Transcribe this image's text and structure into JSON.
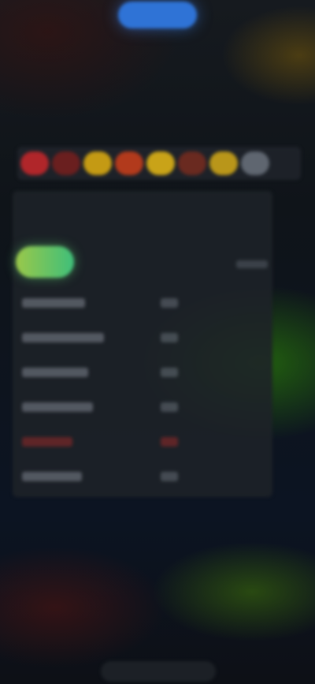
{
  "top_action": {
    "label": ""
  },
  "chips": [
    {
      "label": "",
      "color": "#b0262a"
    },
    {
      "label": "",
      "color": "#6a1f1f"
    },
    {
      "label": "",
      "color": "#c49a14"
    },
    {
      "label": "",
      "color": "#b23a1c"
    },
    {
      "label": "",
      "color": "#c9a318"
    },
    {
      "label": "",
      "color": "#6a2a20"
    },
    {
      "label": "",
      "color": "#b9961a"
    },
    {
      "label": "",
      "color": "#5f6670"
    }
  ],
  "panel": {
    "text_lines": [
      "",
      "",
      ""
    ],
    "badge_label": ""
  },
  "rows": [
    {
      "label": "",
      "value": ""
    },
    {
      "label": "",
      "value": ""
    },
    {
      "label": "",
      "value": ""
    },
    {
      "label": "",
      "value": ""
    },
    {
      "label": "",
      "value": "",
      "status": "warning"
    },
    {
      "label": "",
      "value": ""
    }
  ],
  "colors": {
    "accent_blue": "#2f73d6",
    "badge_green": "#3fbf7a",
    "badge_yellow_green": "#9ac84a",
    "warning_red": "#8c2828"
  }
}
